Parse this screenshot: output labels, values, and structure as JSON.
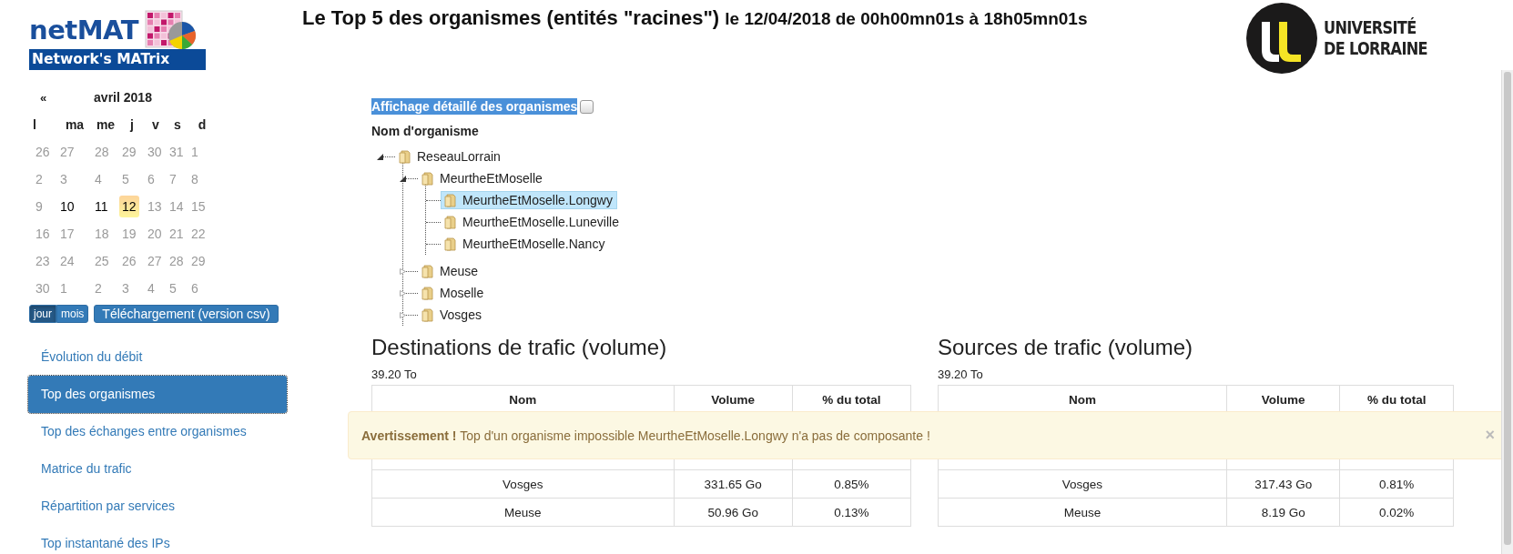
{
  "logo": {
    "name": "netMAT",
    "tagline": "Network's MATrix"
  },
  "title": {
    "main": "Le Top 5 des organismes (entités \"racines\")",
    "period": "le 12/04/2018 de 00h00mn01s à 18h05mn01s"
  },
  "university_logo": {
    "line1": "UNIVERSITÉ",
    "line2": "DE LORRAINE"
  },
  "calendar": {
    "prev": "«",
    "month": "avril 2018",
    "weekdays": [
      "l",
      "ma",
      "me",
      "j",
      "v",
      "s",
      "d"
    ],
    "weeks": [
      [
        {
          "label": "26",
          "disabled": true,
          "selected": false
        },
        {
          "label": "27",
          "disabled": true,
          "selected": false
        },
        {
          "label": "28",
          "disabled": true,
          "selected": false
        },
        {
          "label": "29",
          "disabled": true,
          "selected": false
        },
        {
          "label": "30",
          "disabled": true,
          "selected": false
        },
        {
          "label": "31",
          "disabled": true,
          "selected": false
        },
        {
          "label": "1",
          "disabled": true,
          "selected": false
        }
      ],
      [
        {
          "label": "2",
          "disabled": true,
          "selected": false
        },
        {
          "label": "3",
          "disabled": true,
          "selected": false
        },
        {
          "label": "4",
          "disabled": true,
          "selected": false
        },
        {
          "label": "5",
          "disabled": true,
          "selected": false
        },
        {
          "label": "6",
          "disabled": true,
          "selected": false
        },
        {
          "label": "7",
          "disabled": true,
          "selected": false
        },
        {
          "label": "8",
          "disabled": true,
          "selected": false
        }
      ],
      [
        {
          "label": "9",
          "disabled": true,
          "selected": false
        },
        {
          "label": "10",
          "disabled": false,
          "selected": false
        },
        {
          "label": "11",
          "disabled": false,
          "selected": false
        },
        {
          "label": "12",
          "disabled": false,
          "selected": true
        },
        {
          "label": "13",
          "disabled": true,
          "selected": false
        },
        {
          "label": "14",
          "disabled": true,
          "selected": false
        },
        {
          "label": "15",
          "disabled": true,
          "selected": false
        }
      ],
      [
        {
          "label": "16",
          "disabled": true,
          "selected": false
        },
        {
          "label": "17",
          "disabled": true,
          "selected": false
        },
        {
          "label": "18",
          "disabled": true,
          "selected": false
        },
        {
          "label": "19",
          "disabled": true,
          "selected": false
        },
        {
          "label": "20",
          "disabled": true,
          "selected": false
        },
        {
          "label": "21",
          "disabled": true,
          "selected": false
        },
        {
          "label": "22",
          "disabled": true,
          "selected": false
        }
      ],
      [
        {
          "label": "23",
          "disabled": true,
          "selected": false
        },
        {
          "label": "24",
          "disabled": true,
          "selected": false
        },
        {
          "label": "25",
          "disabled": true,
          "selected": false
        },
        {
          "label": "26",
          "disabled": true,
          "selected": false
        },
        {
          "label": "27",
          "disabled": true,
          "selected": false
        },
        {
          "label": "28",
          "disabled": true,
          "selected": false
        },
        {
          "label": "29",
          "disabled": true,
          "selected": false
        }
      ],
      [
        {
          "label": "30",
          "disabled": true,
          "selected": false
        },
        {
          "label": "1",
          "disabled": true,
          "selected": false
        },
        {
          "label": "2",
          "disabled": true,
          "selected": false
        },
        {
          "label": "3",
          "disabled": true,
          "selected": false
        },
        {
          "label": "4",
          "disabled": true,
          "selected": false
        },
        {
          "label": "5",
          "disabled": true,
          "selected": false
        },
        {
          "label": "6",
          "disabled": true,
          "selected": false
        }
      ]
    ],
    "view_toggle": [
      {
        "label": "jour",
        "selected": true
      },
      {
        "label": "mois",
        "selected": false
      }
    ],
    "download_button": "Téléchargement (version csv)"
  },
  "nav": [
    {
      "label": "Évolution du débit",
      "selected": false
    },
    {
      "label": "Top des organismes",
      "selected": true
    },
    {
      "label": "Top des échanges entre organismes",
      "selected": false
    },
    {
      "label": "Matrice du trafic",
      "selected": false
    },
    {
      "label": "Répartition par services",
      "selected": false
    },
    {
      "label": "Top instantané des IPs",
      "selected": false
    }
  ],
  "detail_option": {
    "label": "Affichage détaillé des organismes",
    "checked": false
  },
  "tree": {
    "heading": "Nom d'organisme",
    "nodes": [
      {
        "label": "ReseauLorrain",
        "expanded": true,
        "selected": false,
        "children": [
          {
            "label": "MeurtheEtMoselle",
            "expanded": true,
            "selected": false,
            "children": [
              {
                "label": "MeurtheEtMoselle.Longwy",
                "selected": true
              },
              {
                "label": "MeurtheEtMoselle.Luneville",
                "selected": false
              },
              {
                "label": "MeurtheEtMoselle.Nancy",
                "selected": false
              }
            ]
          },
          {
            "label": "Meuse",
            "expanded": false,
            "selected": false
          },
          {
            "label": "Moselle",
            "expanded": false,
            "selected": false
          },
          {
            "label": "Vosges",
            "expanded": false,
            "selected": false
          }
        ]
      }
    ]
  },
  "panels": [
    {
      "title": "Destinations de trafic (volume)",
      "total": "39.20 To",
      "columns": [
        "Nom",
        "Volume",
        "% du total"
      ],
      "rows": [
        [
          "Vosges",
          "331.65 Go",
          "0.85%"
        ],
        [
          "Meuse",
          "50.96 Go",
          "0.13%"
        ]
      ]
    },
    {
      "title": "Sources de trafic (volume)",
      "total": "39.20 To",
      "columns": [
        "Nom",
        "Volume",
        "% du total"
      ],
      "rows": [
        [
          "Vosges",
          "317.43 Go",
          "0.81%"
        ],
        [
          "Meuse",
          "8.19 Go",
          "0.02%"
        ]
      ]
    }
  ],
  "alert": {
    "message": "**Avertissement !** Top d'un organisme impossible MeurtheEtMoselle.Longwy n'a pas de composante !",
    "close": "×"
  }
}
